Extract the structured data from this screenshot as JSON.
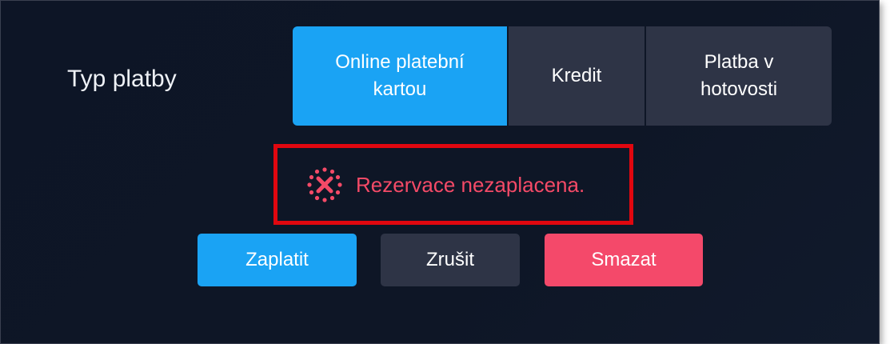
{
  "payment": {
    "label": "Typ platby",
    "options": [
      {
        "label": "Online platební\nkartou",
        "selected": true
      },
      {
        "label": "Kredit",
        "selected": false
      },
      {
        "label": "Platba v\nhotovosti",
        "selected": false
      }
    ]
  },
  "status": {
    "icon": "error-x-circle-icon",
    "text": "Rezervace nezaplacena.",
    "color": "#f44a67",
    "highlight_color": "#e0070f"
  },
  "actions": {
    "pay_label": "Zaplatit",
    "cancel_label": "Zrušit",
    "delete_label": "Smazat"
  },
  "colors": {
    "accent": "#1aa3f4",
    "neutral": "#2e3446",
    "danger": "#f4496a",
    "background": "#0e1626"
  }
}
